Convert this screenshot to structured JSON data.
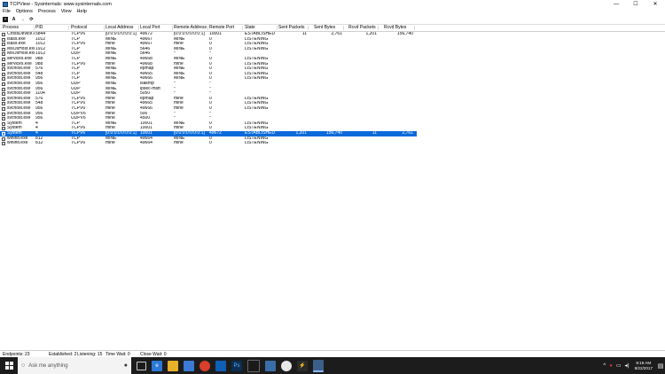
{
  "window": {
    "title": "TCPView - Sysinternals: www.sysinternals.com",
    "minimize": "—",
    "maximize": "☐",
    "close": "✕"
  },
  "menu": [
    "File",
    "Options",
    "Process",
    "View",
    "Help"
  ],
  "toolbar": {
    "save": "▪",
    "resolve": "A",
    "arrow": "→",
    "refresh": "⟳"
  },
  "columns": [
    "Process",
    "PID",
    "Protocol",
    "Local Address",
    "Local Port",
    "Remote Address",
    "Remote Port",
    "State",
    "Sent Packets",
    "Sent Bytes",
    "Rcvd Packets",
    "Rcvd Bytes"
  ],
  "rows": [
    [
      "CrossDevice.Ac...",
      "5844",
      "TCPV6",
      "[0:0:0:0:0:0:0:1]",
      "49672",
      "[0:0:0:0:0:0:0:1]",
      "10001",
      "ESTABLISHED",
      "11",
      "2,761",
      "1,201",
      "156,740"
    ],
    [
      "lsass.exe",
      "1012",
      "TCP",
      "MINE",
      "49667",
      "MINE",
      "0",
      "LISTENING",
      "",
      "",
      "",
      ""
    ],
    [
      "lsass.exe",
      "1012",
      "TCPV6",
      "mine",
      "49667",
      "mine",
      "0",
      "LISTENING",
      "",
      "",
      "",
      ""
    ],
    [
      "MsOsHost.exe",
      "1912",
      "TCP",
      "MINE",
      "5646",
      "MINE",
      "0",
      "LISTENING",
      "",
      "",
      "",
      ""
    ],
    [
      "MsOsHost.exe",
      "1912",
      "UDP",
      "MINE",
      "5646",
      "*",
      "*",
      "",
      "",
      "",
      "",
      ""
    ],
    [
      "services.exe",
      "988",
      "TCP",
      "MINE",
      "49668",
      "MINE",
      "0",
      "LISTENING",
      "",
      "",
      "",
      ""
    ],
    [
      "services.exe",
      "988",
      "TCPV6",
      "mine",
      "49668",
      "mine",
      "0",
      "LISTENING",
      "",
      "",
      "",
      ""
    ],
    [
      "svchost.exe",
      "576",
      "TCP",
      "MINE",
      "epmap",
      "MINE",
      "0",
      "LISTENING",
      "",
      "",
      "",
      ""
    ],
    [
      "svchost.exe",
      "548",
      "TCP",
      "MINE",
      "49665",
      "MINE",
      "0",
      "LISTENING",
      "",
      "",
      "",
      ""
    ],
    [
      "svchost.exe",
      "956",
      "TCP",
      "MINE",
      "49666",
      "MINE",
      "0",
      "LISTENING",
      "",
      "",
      "",
      ""
    ],
    [
      "svchost.exe",
      "956",
      "UDP",
      "MINE",
      "isakmp",
      "*",
      "*",
      "",
      "",
      "",
      "",
      ""
    ],
    [
      "svchost.exe",
      "956",
      "UDP",
      "MINE",
      "ipsec-msft",
      "*",
      "*",
      "",
      "",
      "",
      "",
      ""
    ],
    [
      "svchost.exe",
      "1104",
      "UDP",
      "MINE",
      "5050",
      "*",
      "*",
      "",
      "",
      "",
      "",
      ""
    ],
    [
      "svchost.exe",
      "576",
      "TCPV6",
      "mine",
      "epmap",
      "mine",
      "0",
      "LISTENING",
      "",
      "",
      "",
      ""
    ],
    [
      "svchost.exe",
      "548",
      "TCPV6",
      "mine",
      "49665",
      "mine",
      "0",
      "LISTENING",
      "",
      "",
      "",
      ""
    ],
    [
      "svchost.exe",
      "956",
      "TCPV6",
      "mine",
      "49666",
      "mine",
      "0",
      "LISTENING",
      "",
      "",
      "",
      ""
    ],
    [
      "svchost.exe",
      "956",
      "UDPV6",
      "mine",
      "500",
      "*",
      "*",
      "",
      "",
      "",
      "",
      ""
    ],
    [
      "svchost.exe",
      "956",
      "UDPV6",
      "mine",
      "4500",
      "*",
      "*",
      "",
      "",
      "",
      "",
      ""
    ],
    [
      "System",
      "4",
      "TCP",
      "MINE",
      "10001",
      "MINE",
      "0",
      "LISTENING",
      "",
      "",
      "",
      ""
    ],
    [
      "System",
      "4",
      "TCPV6",
      "mine",
      "10001",
      "mine",
      "0",
      "LISTENING",
      "",
      "",
      "",
      ""
    ],
    [
      "System",
      "4",
      "TCPV6",
      "[0:0:0:0:0:0:0:1]",
      "10001",
      "[0:0:0:0:0:0:0:1]",
      "49672",
      "ESTABLISHED",
      "1,201",
      "156,740",
      "11",
      "2,761"
    ],
    [
      "wininit.exe",
      "812",
      "TCP",
      "MINE",
      "49664",
      "MINE",
      "0",
      "LISTENING",
      "",
      "",
      "",
      ""
    ],
    [
      "wininit.exe",
      "812",
      "TCPV6",
      "mine",
      "49664",
      "mine",
      "0",
      "LISTENING",
      "",
      "",
      "",
      ""
    ]
  ],
  "selected_row": 20,
  "status": {
    "endpoints": "Endpoints: 23",
    "established": "Established: 2",
    "listening": "Listening: 15",
    "time_wait": "Time Wait: 0",
    "close_wait": "Close Wait: 0"
  },
  "taskbar": {
    "search_placeholder": "Ask me anything",
    "time": "9:18 AM",
    "date": "8/22/2017",
    "apps": [
      "task-view-icon",
      "edge-icon",
      "file-explorer-icon",
      "store-icon",
      "chrome-icon",
      "mail-icon",
      "photoshop-icon",
      "terminal-icon",
      "media-icon",
      "tool-icon",
      "sniffer-icon",
      "tcpview-icon"
    ]
  },
  "colors": {
    "selection": "#0a6ad9",
    "taskbar": "#1c1c1c"
  }
}
